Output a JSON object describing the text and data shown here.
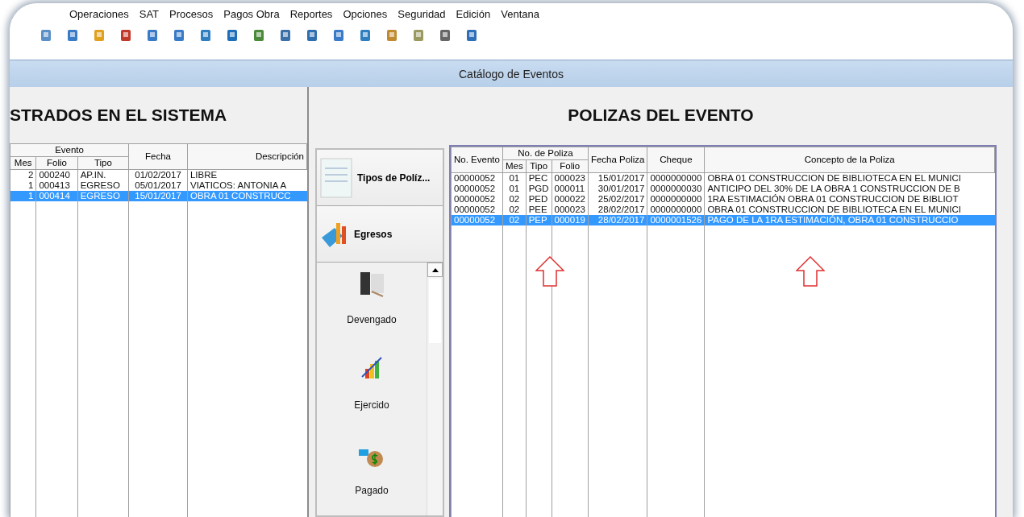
{
  "menu": [
    "Operaciones",
    "SAT",
    "Procesos",
    "Pagos Obra",
    "Reportes",
    "Opciones",
    "Seguridad",
    "Edición",
    "Ventana"
  ],
  "window": {
    "title": "Catálogo de Eventos"
  },
  "left_panel": {
    "title": "STRADOS EN EL SISTEMA",
    "table": {
      "group": "Evento",
      "columns": [
        "Mes",
        "Folio",
        "Tipo",
        "Fecha",
        "Descripción"
      ],
      "rows": [
        {
          "cells": [
            "2",
            "000240",
            "AP.IN.",
            "01/02/2017",
            "LIBRE"
          ],
          "selected": false
        },
        {
          "cells": [
            "1",
            "000413",
            "EGRESO",
            "05/01/2017",
            "VIATICOS: ANTONIA A"
          ],
          "selected": false
        },
        {
          "cells": [
            "1",
            "000414",
            "EGRESO",
            "15/01/2017",
            "OBRA 01 CONSTRUCC"
          ],
          "selected": true
        }
      ]
    }
  },
  "right_panel": {
    "title": "POLIZAS DEL EVENTO",
    "nav": {
      "headers": [
        {
          "label": "Tipos de Políz...",
          "kind": "sheet"
        },
        {
          "label": "Egresos",
          "kind": "chart"
        }
      ],
      "items": [
        {
          "label": "Devengado",
          "kind": "docs"
        },
        {
          "label": "Ejercido",
          "kind": "growth"
        },
        {
          "label": "Pagado",
          "kind": "money"
        }
      ]
    },
    "table": {
      "group": "No. de Poliza",
      "columns": [
        "No. Evento",
        "Mes",
        "Tipo",
        "Folio",
        "Fecha Poliza",
        "Cheque",
        "Concepto de la Poliza"
      ],
      "rows": [
        {
          "cells": [
            "00000052",
            "01",
            "PEC",
            "000023",
            "15/01/2017",
            "0000000000",
            "OBRA 01 CONSTRUCCION DE BIBLIOTECA EN EL MUNICI"
          ],
          "selected": false
        },
        {
          "cells": [
            "00000052",
            "01",
            "PGD",
            "000011",
            "30/01/2017",
            "0000000030",
            "ANTICIPO DEL 30% DE LA OBRA 1 CONSTRUCCION DE B"
          ],
          "selected": false
        },
        {
          "cells": [
            "00000052",
            "02",
            "PED",
            "000022",
            "25/02/2017",
            "0000000000",
            "1RA ESTIMACIÓN OBRA 01 CONSTRUCCION DE BIBLIOT"
          ],
          "selected": false
        },
        {
          "cells": [
            "00000052",
            "02",
            "PEE",
            "000023",
            "28/02/2017",
            "0000000000",
            "OBRA 01 CONSTRUCCION DE BIBLIOTECA EN EL MUNICI"
          ],
          "selected": false
        },
        {
          "cells": [
            "00000052",
            "02",
            "PEP",
            "000019",
            "28/02/2017",
            "0000001526",
            "PAGO DE LA 1RA ESTIMACIÓN, OBRA 01 CONSTRUCCIO"
          ],
          "selected": true
        }
      ]
    }
  }
}
